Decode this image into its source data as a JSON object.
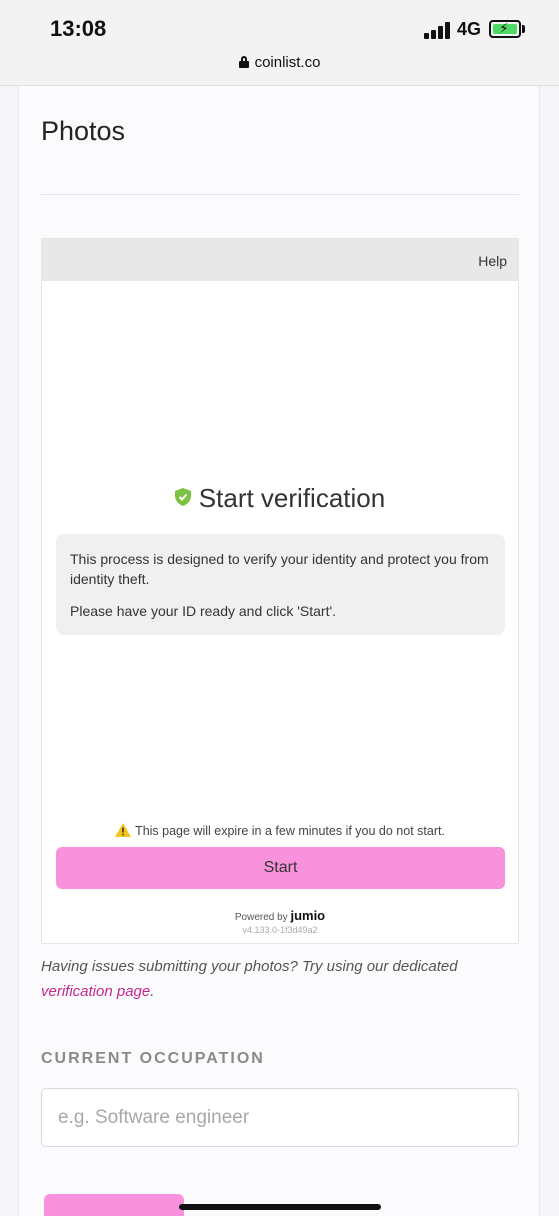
{
  "status_bar": {
    "time": "13:08",
    "network": "4G",
    "url": "coinlist.co"
  },
  "page": {
    "title": "Photos"
  },
  "jumio": {
    "help_label": "Help",
    "heading": "Start verification",
    "info_line_1": "This process is designed to verify your identity and protect you from identity theft.",
    "info_line_2": "Please have your ID ready and click 'Start'.",
    "expire_warning": "This page will expire in a few minutes if you do not start.",
    "start_label": "Start",
    "powered_by": "Powered by",
    "brand": "jumio",
    "version": "v4.133.0-1f3d49a2"
  },
  "issues": {
    "text": "Having issues submitting your photos? Try using our dedicated ",
    "link": "verification page",
    "suffix": "."
  },
  "occupation": {
    "label": "CURRENT OCCUPATION",
    "placeholder": "e.g. Software engineer",
    "value": ""
  },
  "colors": {
    "accent_pink": "#f892dc",
    "link_magenta": "#c4278f",
    "shield_green": "#7cc242",
    "battery_green": "#4cd964"
  }
}
